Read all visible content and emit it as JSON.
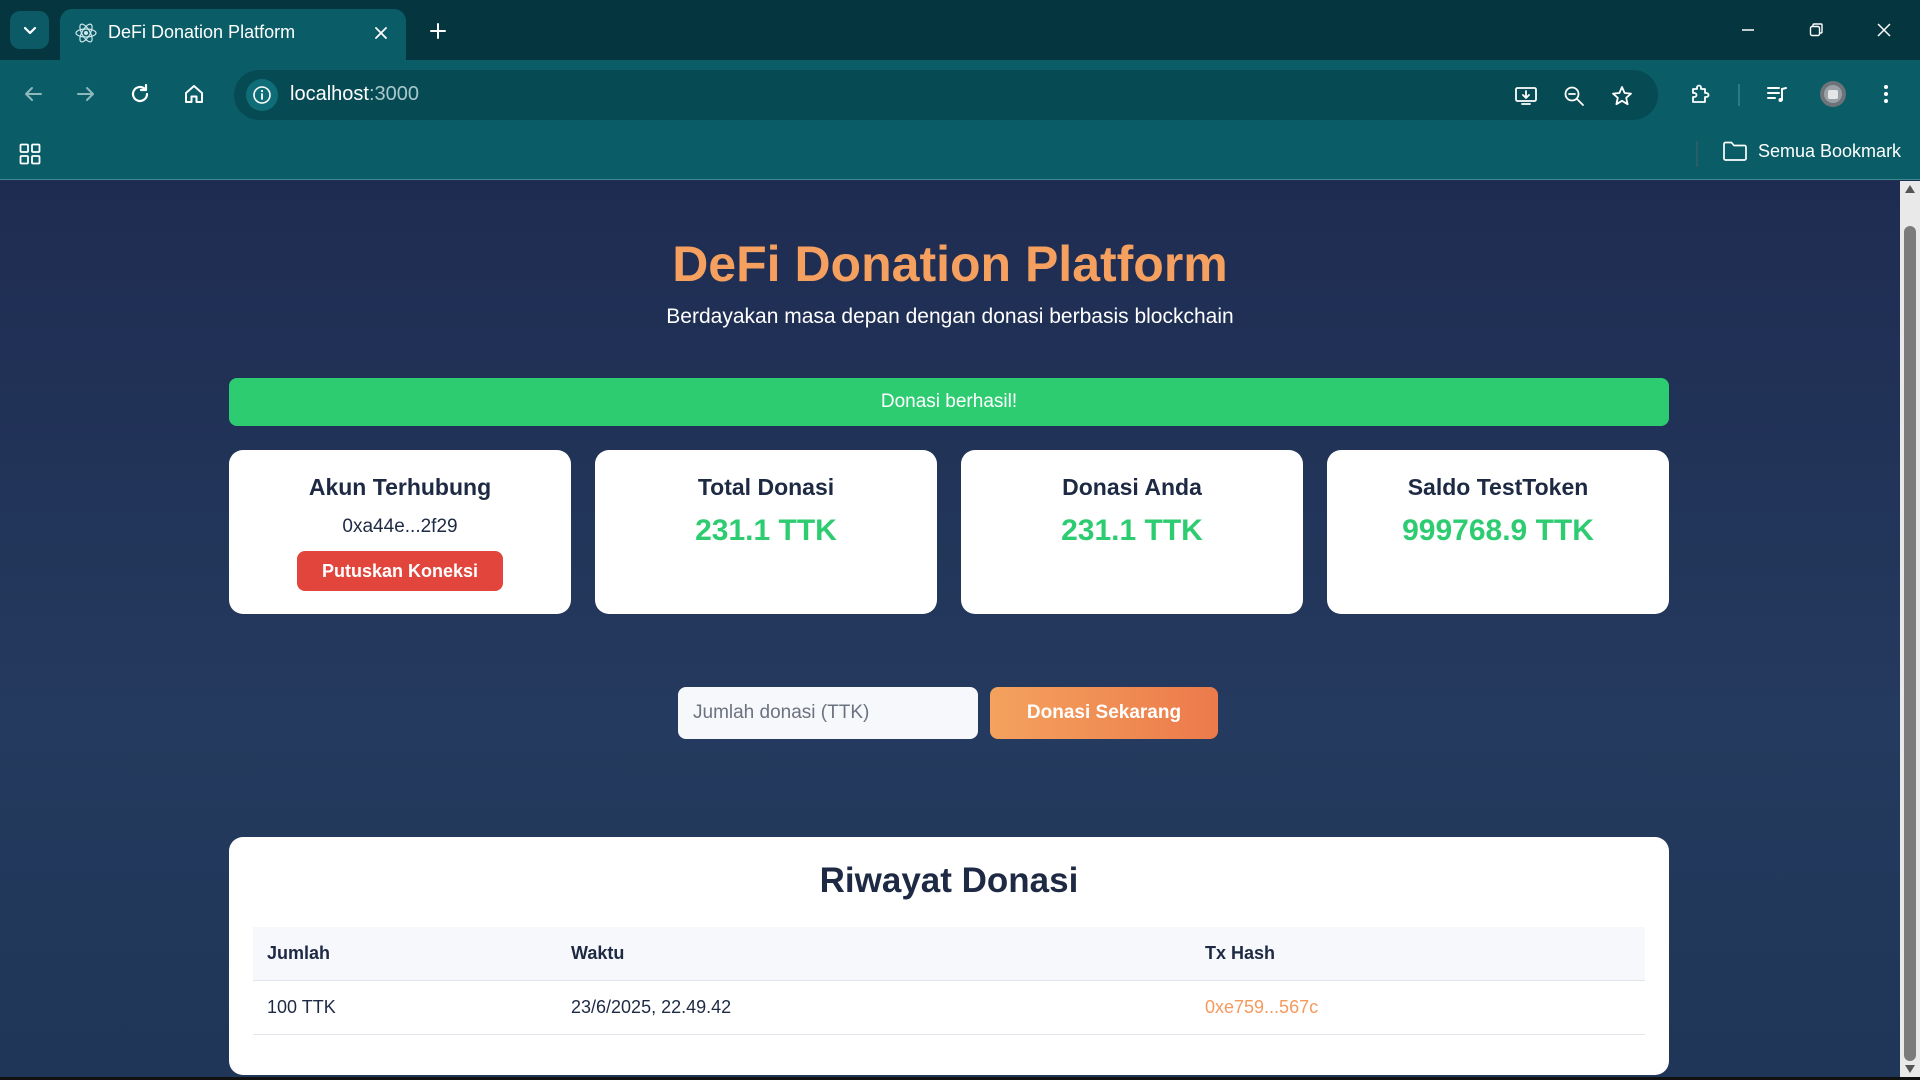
{
  "browser": {
    "tab_title": "DeFi Donation Platform",
    "url_host": "localhost",
    "url_port": ":3000",
    "bookmark_folder": "Semua Bookmark"
  },
  "header": {
    "title": "DeFi Donation Platform",
    "subtitle": "Berdayakan masa depan dengan donasi berbasis blockchain"
  },
  "alert": {
    "message": "Donasi berhasil!",
    "color": "#2ecc71"
  },
  "cards": {
    "account": {
      "title": "Akun Terhubung",
      "address": "0xa44e...2f29",
      "disconnect_label": "Putuskan Koneksi"
    },
    "total": {
      "title": "Total Donasi",
      "value": "231.1 TTK"
    },
    "yours": {
      "title": "Donasi Anda",
      "value": "231.1 TTK"
    },
    "balance": {
      "title": "Saldo TestToken",
      "value": "999768.9 TTK"
    }
  },
  "donate_form": {
    "placeholder": "Jumlah donasi (TTK)",
    "button_label": "Donasi Sekarang"
  },
  "history": {
    "title": "Riwayat Donasi",
    "columns": [
      "Jumlah",
      "Waktu",
      "Tx Hash"
    ],
    "rows": [
      {
        "amount": "100 TTK",
        "time": "23/6/2025, 22.49.42",
        "tx_hash": "0xe759...567c"
      }
    ]
  },
  "colors": {
    "accent": "#f6a05f",
    "success": "#2ecc71",
    "danger": "#e2453c",
    "chrome": "#0a5c67"
  }
}
